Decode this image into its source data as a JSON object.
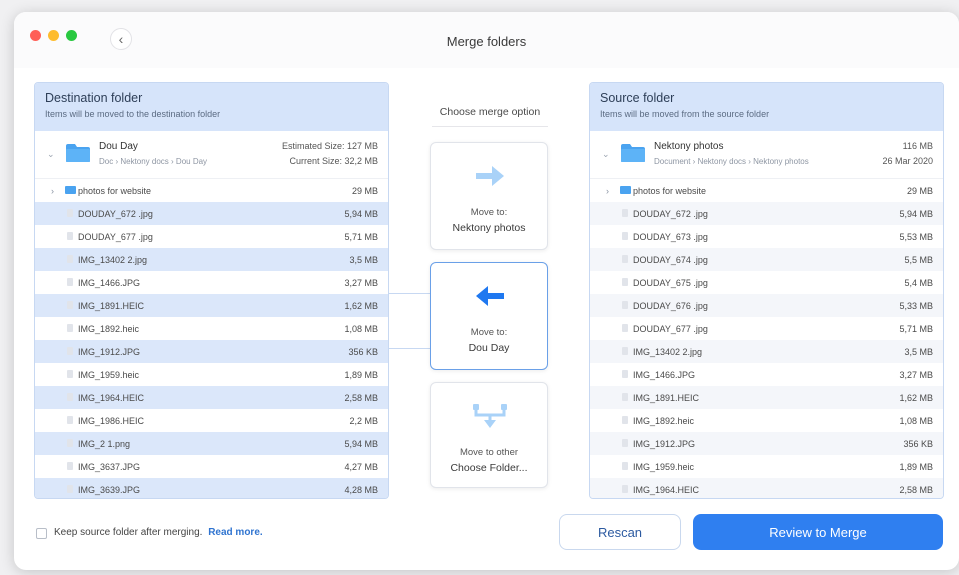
{
  "window": {
    "title": "Merge folders"
  },
  "colors": {
    "accent": "#2f7ff0",
    "panel_header": "#d6e4fa",
    "folder_blue": "#4aa3f0",
    "arrow_light": "#a9d2f8",
    "arrow_dark": "#1f78f0"
  },
  "destination": {
    "title": "Destination folder",
    "subtitle": "Items will be moved to the destination folder",
    "folder": {
      "name": "Dou Day",
      "path": "Doc › Nektony docs › Dou Day",
      "estimated_size": "Estimated Size: 127 MB",
      "current_size": "Current Size: 32,2 MB"
    },
    "items": [
      {
        "name": "photos for website",
        "size": "29 MB",
        "type": "folder"
      },
      {
        "name": "DOUDAY_672 .jpg",
        "size": "5,94 MB",
        "type": "file"
      },
      {
        "name": "DOUDAY_677 .jpg",
        "size": "5,71 MB",
        "type": "file"
      },
      {
        "name": "IMG_13402 2.jpg",
        "size": "3,5 MB",
        "type": "file"
      },
      {
        "name": "IMG_1466.JPG",
        "size": "3,27 MB",
        "type": "file"
      },
      {
        "name": "IMG_1891.HEIC",
        "size": "1,62 MB",
        "type": "file"
      },
      {
        "name": "IMG_1892.heic",
        "size": "1,08 MB",
        "type": "file"
      },
      {
        "name": "IMG_1912.JPG",
        "size": "356 KB",
        "type": "file"
      },
      {
        "name": "IMG_1959.heic",
        "size": "1,89 MB",
        "type": "file"
      },
      {
        "name": "IMG_1964.HEIC",
        "size": "2,58 MB",
        "type": "file"
      },
      {
        "name": "IMG_1986.HEIC",
        "size": "2,2 MB",
        "type": "file"
      },
      {
        "name": "IMG_2 1.png",
        "size": "5,94 MB",
        "type": "file"
      },
      {
        "name": "IMG_3637.JPG",
        "size": "4,27 MB",
        "type": "file"
      },
      {
        "name": "IMG_3639.JPG",
        "size": "4,28 MB",
        "type": "file"
      }
    ]
  },
  "source": {
    "title": "Source folder",
    "subtitle": "Items will be moved from the source folder",
    "folder": {
      "name": "Nektony photos",
      "path": "Document › Nektony docs › Nektony photos",
      "size": "116 MB",
      "date": "26 Mar 2020"
    },
    "items": [
      {
        "name": "photos for website",
        "size": "29 MB",
        "type": "folder"
      },
      {
        "name": "DOUDAY_672 .jpg",
        "size": "5,94 MB",
        "type": "file"
      },
      {
        "name": "DOUDAY_673 .jpg",
        "size": "5,53 MB",
        "type": "file"
      },
      {
        "name": "DOUDAY_674 .jpg",
        "size": "5,5 MB",
        "type": "file"
      },
      {
        "name": "DOUDAY_675 .jpg",
        "size": "5,4 MB",
        "type": "file"
      },
      {
        "name": "DOUDAY_676 .jpg",
        "size": "5,33 MB",
        "type": "file"
      },
      {
        "name": "DOUDAY_677 .jpg",
        "size": "5,71 MB",
        "type": "file"
      },
      {
        "name": "IMG_13402 2.jpg",
        "size": "3,5 MB",
        "type": "file"
      },
      {
        "name": "IMG_1466.JPG",
        "size": "3,27 MB",
        "type": "file"
      },
      {
        "name": "IMG_1891.HEIC",
        "size": "1,62 MB",
        "type": "file"
      },
      {
        "name": "IMG_1892.heic",
        "size": "1,08 MB",
        "type": "file"
      },
      {
        "name": "IMG_1912.JPG",
        "size": "356 KB",
        "type": "file"
      },
      {
        "name": "IMG_1959.heic",
        "size": "1,89 MB",
        "type": "file"
      },
      {
        "name": "IMG_1964.HEIC",
        "size": "2,58 MB",
        "type": "file"
      }
    ]
  },
  "merge_options": {
    "label": "Choose merge option",
    "options": [
      {
        "line1": "Move to:",
        "line2": "Nektony photos",
        "icon": "arrow-right-icon",
        "selected": false
      },
      {
        "line1": "Move to:",
        "line2": "Dou Day",
        "icon": "arrow-left-icon",
        "selected": true
      },
      {
        "line1": "Move to other",
        "line2": "Choose Folder...",
        "icon": "merge-down-icon",
        "selected": false
      }
    ]
  },
  "footer": {
    "checkbox_label": "Keep source folder after merging.",
    "read_more": "Read more.",
    "checked": false,
    "rescan_label": "Rescan",
    "review_label": "Review to Merge"
  }
}
